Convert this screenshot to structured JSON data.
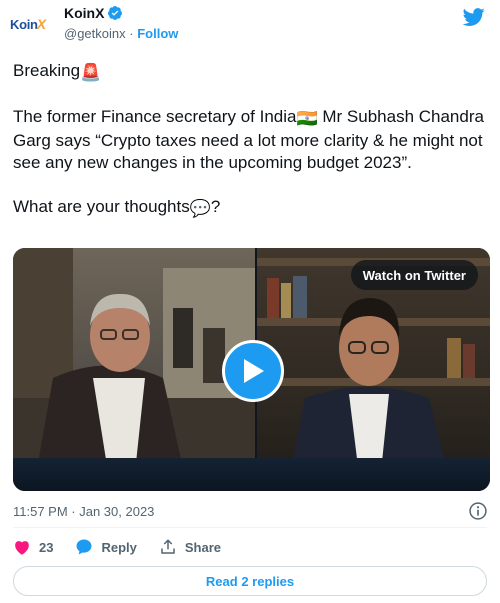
{
  "header": {
    "logo_text": "Koin",
    "logo_accent": "X",
    "display_name": "KoinX",
    "handle": "@getkoinx",
    "separator": "·",
    "follow_label": "Follow"
  },
  "tweet": {
    "line_breaking": "Breaking",
    "breaking_emoji": "🚨",
    "para_start": "The former Finance secretary of India",
    "flag_emoji": "🇮🇳",
    "para_end": " Mr Subhash Chandra Garg says “Crypto taxes need a lot more clarity & he might not see any new changes in the upcoming budget 2023”.",
    "question_start": "What are your thoughts",
    "speech_emoji": "💬",
    "question_end": "?"
  },
  "media": {
    "watch_label": "Watch on Twitter"
  },
  "meta": {
    "timestamp": "11:57 PM · Jan 30, 2023"
  },
  "actions": {
    "like_count": "23",
    "reply_label": "Reply",
    "share_label": "Share"
  },
  "footer": {
    "read_replies_label": "Read 2 replies"
  },
  "colors": {
    "accent": "#1d9bf0",
    "like": "#f91880",
    "text": "#0f1419",
    "muted": "#536471"
  }
}
